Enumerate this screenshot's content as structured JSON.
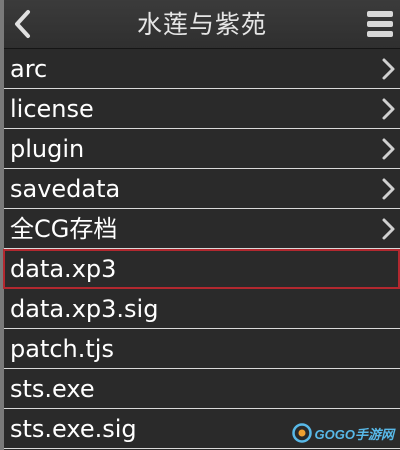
{
  "header": {
    "title": "水莲与紫苑",
    "back_icon": "chevron-left-icon",
    "menu_icon": "hamburger-menu-icon"
  },
  "files": [
    {
      "name": "arc",
      "is_folder": true
    },
    {
      "name": "license",
      "is_folder": true
    },
    {
      "name": "plugin",
      "is_folder": true
    },
    {
      "name": "savedata",
      "is_folder": true
    },
    {
      "name": "全CG存档",
      "is_folder": true
    },
    {
      "name": "data.xp3",
      "is_folder": false,
      "selected": true
    },
    {
      "name": "data.xp3.sig",
      "is_folder": false
    },
    {
      "name": "patch.tjs",
      "is_folder": false
    },
    {
      "name": "sts.exe",
      "is_folder": false
    },
    {
      "name": "sts.exe.sig",
      "is_folder": false
    }
  ],
  "watermark": {
    "text": "GOGO手游网"
  },
  "colors": {
    "background": "#2a2a2a",
    "divider": "#d9d9d9",
    "selection": "#b2282f",
    "text": "#ffffff"
  }
}
